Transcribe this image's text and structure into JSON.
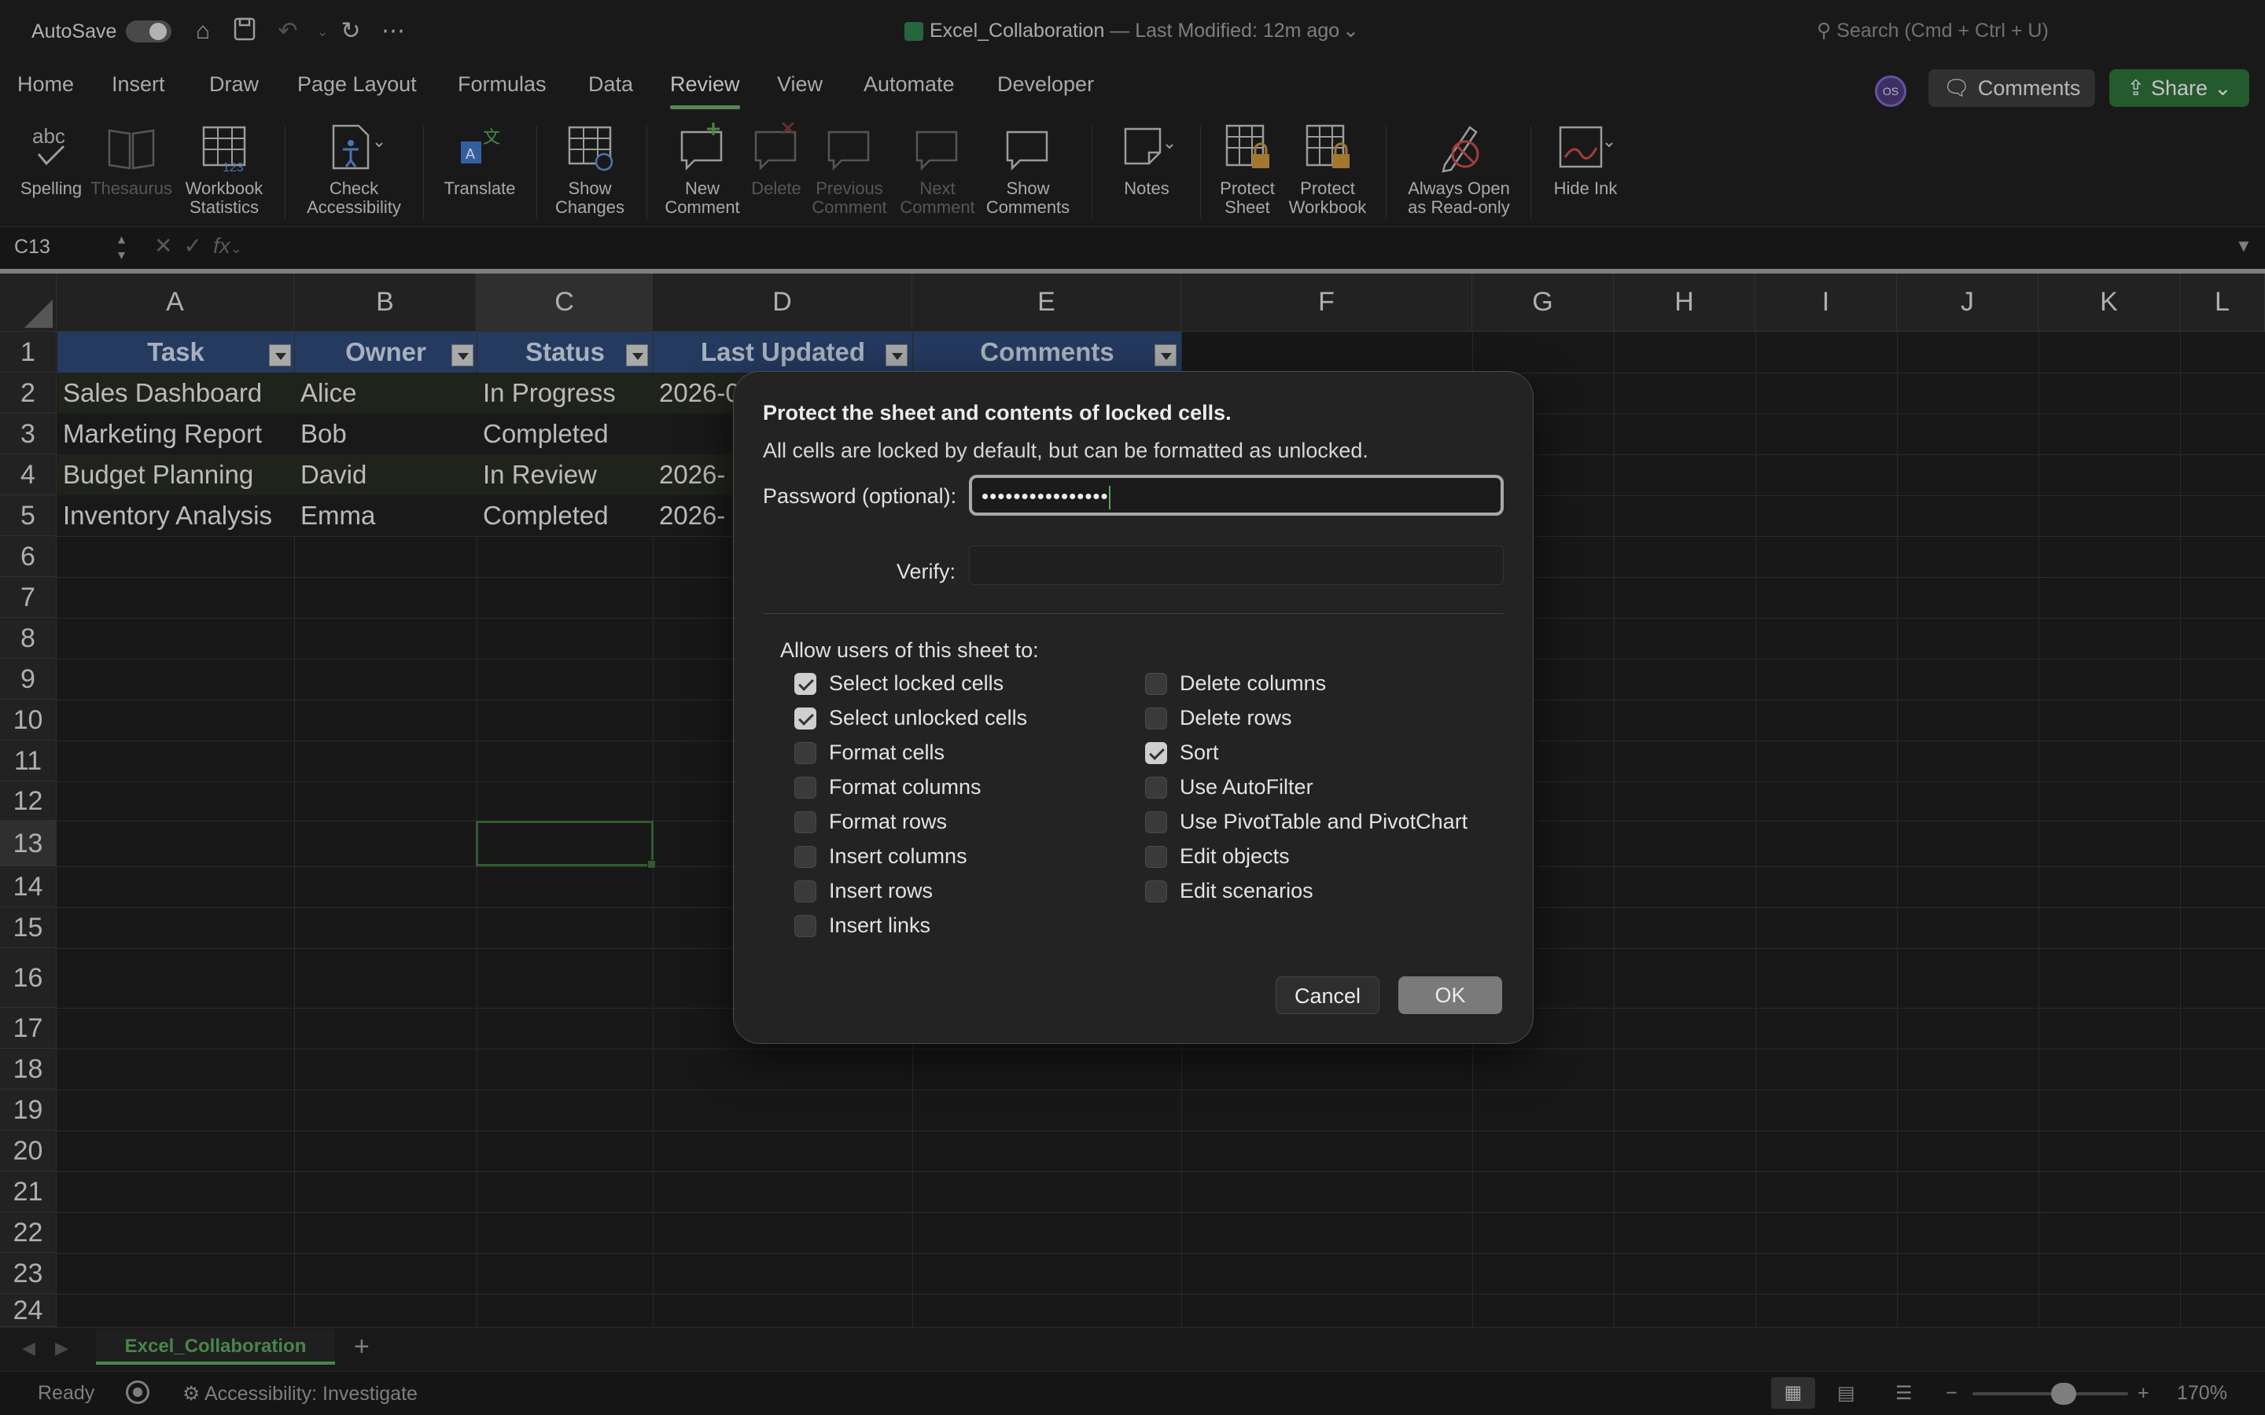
{
  "titlebar": {
    "autosave_label": "AutoSave",
    "title": "Excel_Collaboration",
    "modified": " — Last Modified: 12m ago",
    "search_placeholder": "Search (Cmd + Ctrl + U)"
  },
  "menu": {
    "tabs": [
      "Home",
      "Insert",
      "Draw",
      "Page Layout",
      "Formulas",
      "Data",
      "Review",
      "View",
      "Automate",
      "Developer"
    ],
    "active": "Review",
    "avatar": "OS",
    "comments_label": "Comments",
    "share_label": "Share"
  },
  "ribbon": {
    "spelling": "Spelling",
    "thesaurus": "Thesaurus",
    "workbook_stats_1": "Workbook",
    "workbook_stats_2": "Statistics",
    "check_access_1": "Check",
    "check_access_2": "Accessibility",
    "translate": "Translate",
    "show_changes_1": "Show",
    "show_changes_2": "Changes",
    "new_comment_1": "New",
    "new_comment_2": "Comment",
    "delete": "Delete",
    "prev_comment_1": "Previous",
    "prev_comment_2": "Comment",
    "next_comment_1": "Next",
    "next_comment_2": "Comment",
    "show_comments_1": "Show",
    "show_comments_2": "Comments",
    "notes": "Notes",
    "protect_sheet_1": "Protect",
    "protect_sheet_2": "Sheet",
    "protect_workbook_1": "Protect",
    "protect_workbook_2": "Workbook",
    "always_open_1": "Always Open",
    "always_open_2": "as Read-only",
    "hide_ink": "Hide Ink"
  },
  "formula_bar": {
    "name_box": "C13",
    "fx": "fx"
  },
  "sheet": {
    "columns": [
      "A",
      "B",
      "C",
      "D",
      "E",
      "F",
      "G",
      "H",
      "I",
      "J",
      "K",
      "L"
    ],
    "rows": [
      "1",
      "2",
      "3",
      "4",
      "5",
      "6",
      "7",
      "8",
      "9",
      "10",
      "11",
      "12",
      "13",
      "14",
      "15",
      "16",
      "17",
      "18",
      "19",
      "20",
      "21",
      "22",
      "23",
      "24"
    ],
    "table_headers": [
      "Task",
      "Owner",
      "Status",
      "Last Updated",
      "Comments"
    ],
    "table_rows": [
      [
        "Sales Dashboard",
        "Alice",
        "In Progress",
        "2026-0"
      ],
      [
        "Marketing Report",
        "Bob",
        "Completed",
        ""
      ],
      [
        "Budget Planning",
        "David",
        "In Review",
        "2026-"
      ],
      [
        "Inventory Analysis",
        "Emma",
        "Completed",
        "2026-"
      ]
    ],
    "tab_name": "Excel_Collaboration",
    "add_sheet": "+"
  },
  "status": {
    "ready": "Ready",
    "accessibility": "Accessibility: Investigate",
    "zoom": "170%",
    "zoom_minus": "−",
    "zoom_plus": "+"
  },
  "dialog": {
    "title": "Protect the sheet and contents of locked cells.",
    "subtitle": "All cells are locked by default, but can be formatted as unlocked.",
    "password_label": "Password (optional):",
    "password_value": "••••••••••••••••",
    "verify_label": "Verify:",
    "allow_label": "Allow users of this sheet to:",
    "left_options": [
      {
        "label": "Select locked cells",
        "checked": true
      },
      {
        "label": "Select unlocked cells",
        "checked": true
      },
      {
        "label": "Format cells",
        "checked": false
      },
      {
        "label": "Format columns",
        "checked": false
      },
      {
        "label": "Format rows",
        "checked": false
      },
      {
        "label": "Insert columns",
        "checked": false
      },
      {
        "label": "Insert rows",
        "checked": false
      },
      {
        "label": "Insert links",
        "checked": false
      }
    ],
    "right_options": [
      {
        "label": "Delete columns",
        "checked": false
      },
      {
        "label": "Delete rows",
        "checked": false
      },
      {
        "label": "Sort",
        "checked": true
      },
      {
        "label": "Use AutoFilter",
        "checked": false
      },
      {
        "label": "Use PivotTable and PivotChart",
        "checked": false
      },
      {
        "label": "Edit objects",
        "checked": false
      },
      {
        "label": "Edit scenarios",
        "checked": false
      }
    ],
    "cancel_label": "Cancel",
    "ok_label": "OK"
  },
  "colors": {
    "accent_green": "#5aa45a",
    "table_header": "#2d4774",
    "share_button": "#2c6e39"
  }
}
